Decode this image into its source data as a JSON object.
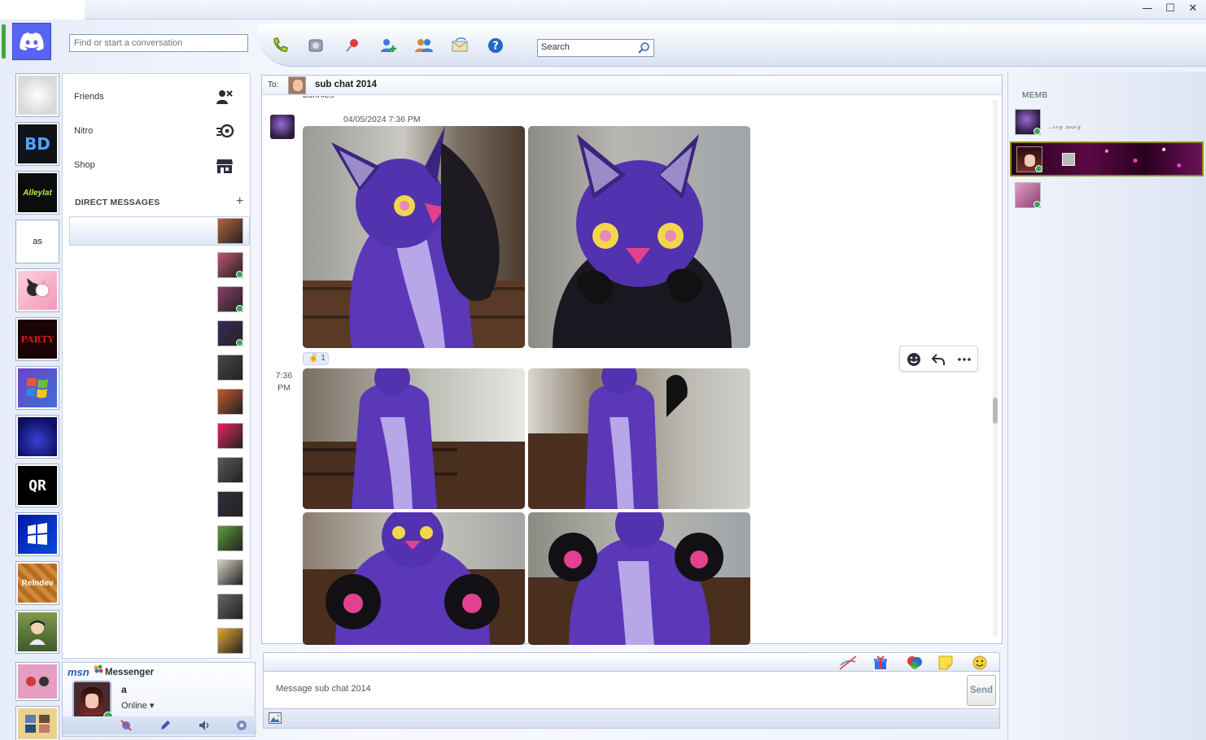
{
  "window": {
    "minimize_glyph": "—",
    "maximize_glyph": "☐",
    "close_glyph": "✕"
  },
  "toolbar": {
    "find_placeholder": "Find or start a conversation",
    "search_placeholder": "Search",
    "icons": [
      "call-icon",
      "video-icon",
      "pin-icon",
      "add-friend-icon",
      "members-icon",
      "inbox-icon",
      "help-icon"
    ]
  },
  "servers": [
    {
      "name": "server-globe",
      "label": "",
      "bg": "#f2f2f2"
    },
    {
      "name": "server-bd",
      "label": "BD",
      "bg": "#101418"
    },
    {
      "name": "server-alleylat",
      "label": "Alleylat",
      "bg": "#0c0c0c"
    },
    {
      "name": "server-as",
      "label": "as",
      "bg": "#ffffff"
    },
    {
      "name": "server-kuromi",
      "label": "",
      "bg": "#f7b9cf"
    },
    {
      "name": "server-playboi",
      "label": "PARTY",
      "bg": "#1a0406"
    },
    {
      "name": "server-windows-xp",
      "label": "",
      "bg": "#5b3ea7"
    },
    {
      "name": "server-cat",
      "label": "",
      "bg": "#0b1060"
    },
    {
      "name": "server-qr",
      "label": "QR",
      "bg": "#000000"
    },
    {
      "name": "server-win95",
      "label": "",
      "bg": "#0018a8"
    },
    {
      "name": "server-reindev",
      "label": "ReIndev",
      "bg": "#b66b1e"
    },
    {
      "name": "server-boy",
      "label": "",
      "bg": "#6c8a3c"
    },
    {
      "name": "server-folder-1",
      "label": "",
      "bg": "#e59dc1"
    },
    {
      "name": "server-folder-2",
      "label": "",
      "bg": "#e8d28e"
    }
  ],
  "nav": {
    "friends": "Friends",
    "nitro": "Nitro",
    "shop": "Shop",
    "direct_messages": "DIRECT MESSAGES",
    "add_dm": "+"
  },
  "dm_avatars": [
    "#b8633f",
    "#c2536f",
    "#8d3d6e",
    "#3b2b57",
    "#4a4644",
    "#c65a2a",
    "#e8245e",
    "#5a5a5a",
    "#2e2f3d",
    "#5e9e3a",
    "#d5d0c5",
    "#656565",
    "#e3a634"
  ],
  "user": {
    "brand_logo": "msn",
    "brand_title": "Messenger",
    "name": "a",
    "status": "Online ▾"
  },
  "chat": {
    "to_label": "To:",
    "channel_name": "sub chat 2014",
    "previous_author": "bunnies",
    "timestamp": "04/05/2024 7:36 PM",
    "reaction_count": "1",
    "side_time": "7:36 PM",
    "photo_count": 6
  },
  "compose": {
    "placeholder": "Message sub chat 2014",
    "send_label": "Send"
  },
  "members": {
    "title": "MEMB",
    "rows": [
      {
        "name": "member-1",
        "label": "...my story",
        "color": "#3b2b57"
      },
      {
        "name": "member-2",
        "label": "",
        "color": "#5a2030"
      },
      {
        "name": "member-3",
        "label": "",
        "color": "#8d3d6e"
      }
    ]
  },
  "colors": {
    "discord_blurple": "#5865f2",
    "online_green": "#3ba55c",
    "purple_fur": "#5b38b8",
    "pink_accent": "#e3418f"
  }
}
